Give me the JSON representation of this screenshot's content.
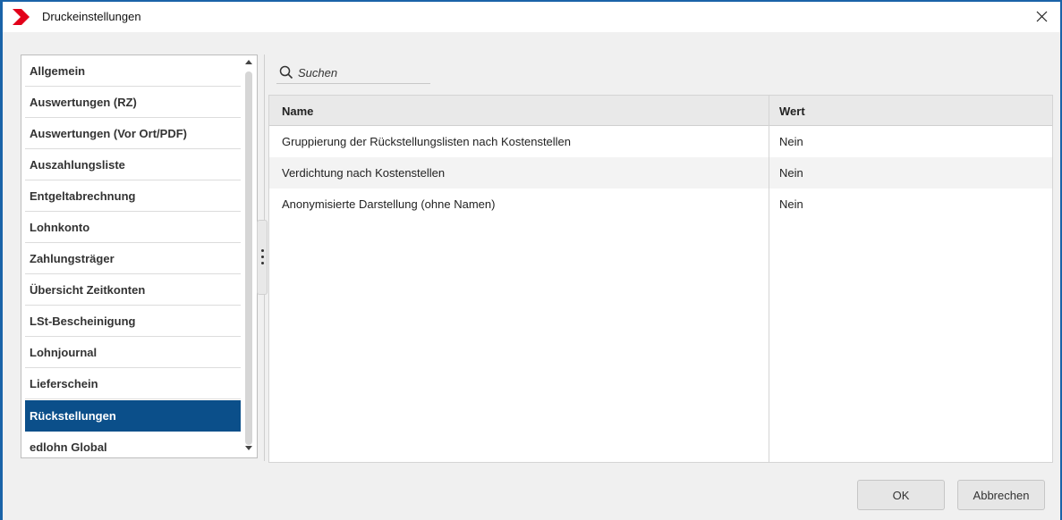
{
  "window": {
    "title": "Druckeinstellungen"
  },
  "sidebar": {
    "items": [
      {
        "label": "Allgemein"
      },
      {
        "label": "Auswertungen (RZ)"
      },
      {
        "label": "Auswertungen (Vor Ort/PDF)"
      },
      {
        "label": "Auszahlungsliste"
      },
      {
        "label": "Entgeltabrechnung"
      },
      {
        "label": "Lohnkonto"
      },
      {
        "label": "Zahlungsträger"
      },
      {
        "label": "Übersicht Zeitkonten"
      },
      {
        "label": "LSt-Bescheinigung"
      },
      {
        "label": "Lohnjournal"
      },
      {
        "label": "Lieferschein"
      },
      {
        "label": "Rückstellungen"
      },
      {
        "label": "edlohn Global"
      }
    ],
    "selected": "Rückstellungen"
  },
  "search": {
    "placeholder": "Suchen"
  },
  "table": {
    "columns": [
      "Name",
      "Wert"
    ],
    "rows": [
      {
        "name": "Gruppierung der Rückstellungslisten nach Kostenstellen",
        "wert": "Nein"
      },
      {
        "name": "Verdichtung nach Kostenstellen",
        "wert": "Nein"
      },
      {
        "name": "Anonymisierte Darstellung (ohne Namen)",
        "wert": "Nein"
      }
    ]
  },
  "buttons": {
    "ok": "OK",
    "cancel": "Abbrechen"
  },
  "colors": {
    "accent": "#0b4f8a",
    "window_border": "#1a63a8",
    "logo": "#e2001a"
  },
  "icons": {
    "app": "chevron-logo-icon",
    "close": "close-icon",
    "search": "search-icon"
  }
}
